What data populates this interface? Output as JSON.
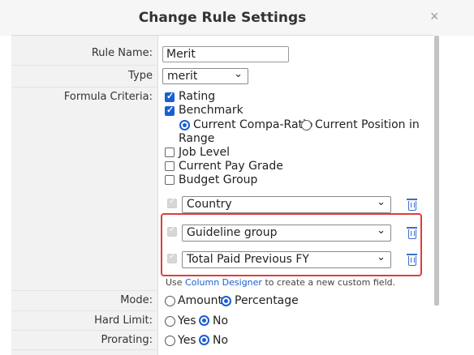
{
  "dialog": {
    "title": "Change Rule Settings",
    "close_glyph": "×"
  },
  "labels": {
    "rule_name": "Rule Name:",
    "type": "Type",
    "formula_criteria": "Formula Criteria:",
    "mode": "Mode:",
    "hard_limit": "Hard Limit:",
    "prorating": "Prorating:"
  },
  "rule_name": {
    "value": "Merit"
  },
  "type": {
    "selected": "merit"
  },
  "criteria": {
    "rating": {
      "label": "Rating",
      "checked": true
    },
    "benchmark": {
      "label": "Benchmark",
      "checked": true
    },
    "benchmark_options": {
      "current_compa_ratio": "Current Compa-Ratio",
      "current_position_line1": "Current Position in",
      "current_position_line2": "Range",
      "selected": "Current Compa-Ratio"
    },
    "job_level": {
      "label": "Job Level",
      "checked": false
    },
    "current_pay_grade": {
      "label": "Current Pay Grade",
      "checked": false
    },
    "budget_group": {
      "label": "Budget Group",
      "checked": false
    }
  },
  "custom_fields": [
    {
      "selected": "Country"
    },
    {
      "selected": "Guideline group"
    },
    {
      "selected": "Total Paid Previous FY"
    }
  ],
  "hint": {
    "prefix": "Use ",
    "link": "Column Designer",
    "suffix": " to create a new custom field."
  },
  "mode": {
    "amount": "Amount",
    "percentage": "Percentage",
    "selected": "Percentage"
  },
  "hard_limit": {
    "yes": "Yes",
    "no": "No",
    "selected": "No"
  },
  "prorating": {
    "yes": "Yes",
    "no": "No",
    "selected": "No"
  },
  "colors": {
    "accent": "#1a5fcf",
    "highlight": "#e03c3c"
  },
  "icons": {
    "close": "close-icon",
    "delete": "trash-icon",
    "dropdown": "chevron-down-icon"
  }
}
